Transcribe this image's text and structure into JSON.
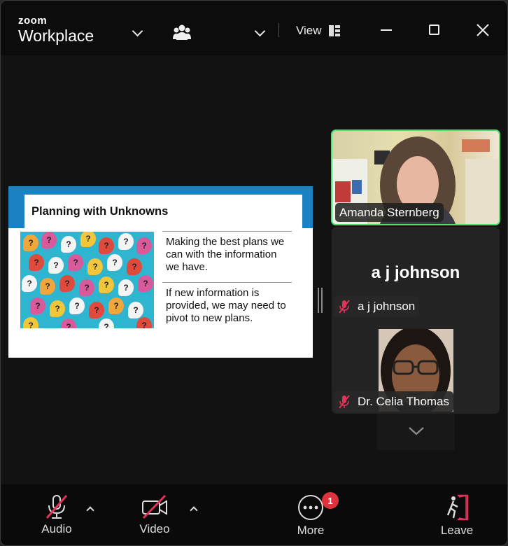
{
  "app": {
    "brand_small": "zoom",
    "brand_big": "Workplace",
    "view_label": "View"
  },
  "slide": {
    "title": "Planning with Unknowns",
    "paragraph1": "Making the best plans we can with the information we have.",
    "paragraph2": "If new information is provided, we may need to pivot to new plans."
  },
  "participants": {
    "active_speaker": "Amanda Sternberg",
    "aj_display": "a j johnson",
    "aj_tag": "a j johnson",
    "celia_tag": "Dr. Celia Thomas"
  },
  "toolbar": {
    "audio_label": "Audio",
    "video_label": "Video",
    "more_label": "More",
    "more_badge": "1",
    "leave_label": "Leave"
  },
  "colors": {
    "speaker_border": "#4be070",
    "badge": "#e0323c",
    "slide_accent": "#1a81c3",
    "mute_slash": "#e0335a"
  },
  "icons": [
    "chevron-down-icon",
    "participants-icon",
    "view-layout-icon",
    "minimize-icon",
    "maximize-icon",
    "close-icon",
    "mic-muted-icon",
    "video-off-icon",
    "more-icon",
    "leave-icon"
  ]
}
